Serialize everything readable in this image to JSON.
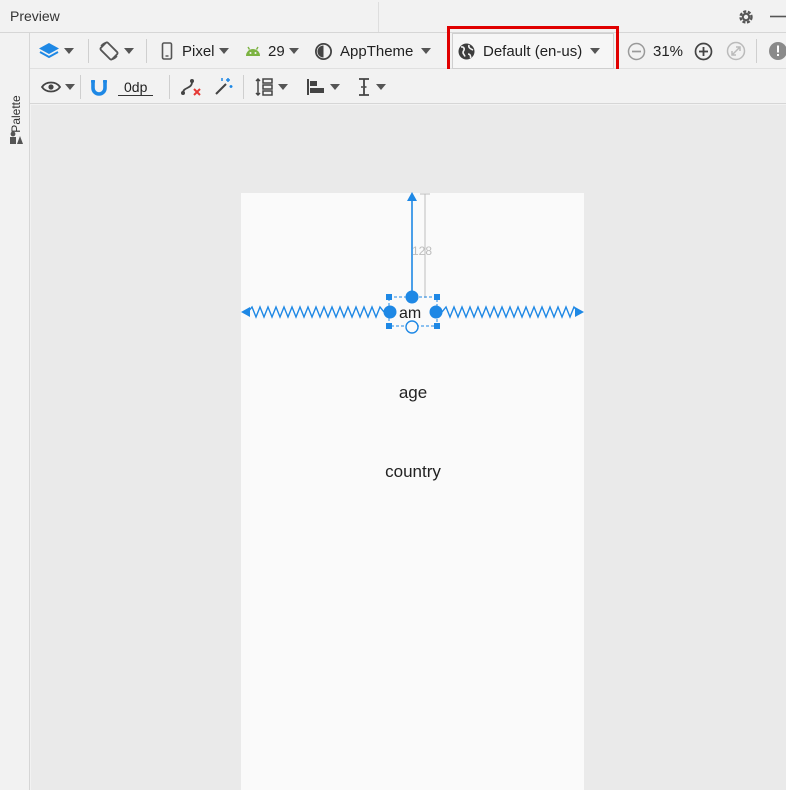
{
  "window": {
    "title": "Preview"
  },
  "palette": {
    "label": "Palette"
  },
  "toolbar_top": {
    "device": "Pixel",
    "api_level": "29",
    "theme": "AppTheme",
    "locale": "Default (en-us)",
    "zoom": "31%"
  },
  "toolbar_bottom": {
    "default_margin": "0dp"
  },
  "layout": {
    "selected_widget_text": "am",
    "top_constraint_margin": "128",
    "items": [
      "age",
      "country"
    ]
  },
  "colors": {
    "accent": "#1e88e5",
    "highlight": "#e00000",
    "android_green": "#7cb342"
  }
}
